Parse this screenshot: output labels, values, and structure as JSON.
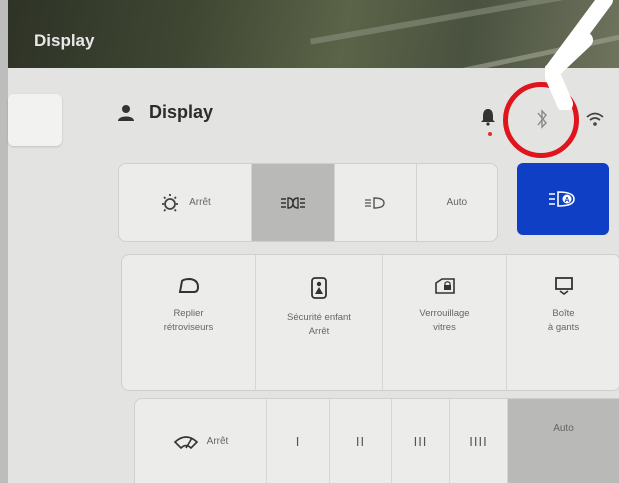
{
  "map": {
    "title": "Display"
  },
  "header": {
    "title": "Display"
  },
  "lights": {
    "off_label": "Arrêt",
    "auto_label": "Auto",
    "auto_headlights_selected": true
  },
  "tiles": [
    {
      "label": "Replier\nrétroviseurs",
      "icon": "mirror-fold-icon"
    },
    {
      "label": "Sécurité enfant\nArrêt",
      "icon": "child-lock-icon"
    },
    {
      "label": "Verrouillage\nvitres",
      "icon": "window-lock-icon"
    },
    {
      "label": "Boîte\nà gants",
      "icon": "glovebox-icon"
    }
  ],
  "wipers": {
    "off_label": "Arrêt",
    "speeds": [
      "I",
      "II",
      "III",
      "IIII"
    ],
    "auto_label": "Auto"
  },
  "colors": {
    "accent": "#0e3fc4",
    "annotation": "#e0141c",
    "selected": "#b9b9b7"
  }
}
